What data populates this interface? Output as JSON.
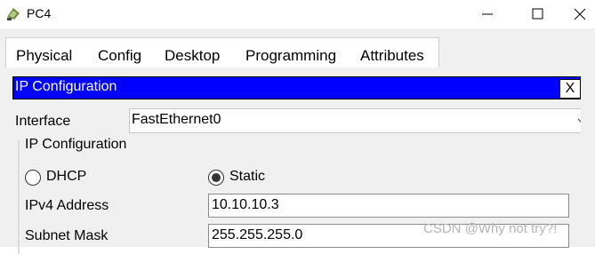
{
  "window": {
    "title": "PC4"
  },
  "tabs": [
    {
      "label": "Physical",
      "active": false
    },
    {
      "label": "Config",
      "active": false
    },
    {
      "label": "Desktop",
      "active": true
    },
    {
      "label": "Programming",
      "active": false
    },
    {
      "label": "Attributes",
      "active": false
    }
  ],
  "panel": {
    "title": "IP Configuration",
    "close_label": "X",
    "interface_label": "Interface",
    "interface_value": "FastEthernet0",
    "group_title": "IP Configuration",
    "dhcp_label": "DHCP",
    "static_label": "Static",
    "selected_mode": "Static",
    "ipv4_label": "IPv4 Address",
    "ipv4_value": "10.10.10.3",
    "subnet_label": "Subnet Mask",
    "subnet_value": "255.255.255.0"
  },
  "watermark": "CSDN @Why not try?!",
  "colors": {
    "header_bar": "#0000ff",
    "tab_underline": "#1b3a64",
    "background": "#f0f0f0"
  },
  "icons": {
    "app": "pc-icon",
    "minimize": "minimize-icon",
    "maximize": "maximize-icon",
    "close": "close-icon",
    "dropdown": "chevron-down-icon"
  }
}
